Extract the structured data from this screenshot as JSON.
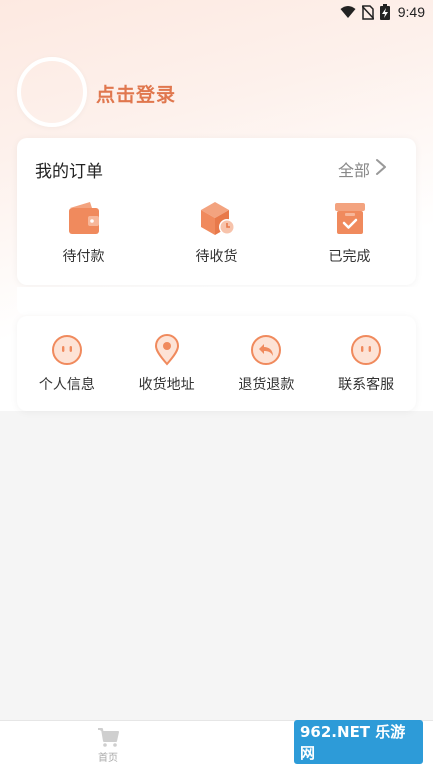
{
  "status_bar": {
    "time": "9:49"
  },
  "profile": {
    "login_label": "点击登录"
  },
  "orders": {
    "title": "我的订单",
    "all_label": "全部",
    "items": [
      {
        "label": "待付款",
        "icon": "wallet-icon"
      },
      {
        "label": "待收货",
        "icon": "box-clock-icon"
      },
      {
        "label": "已完成",
        "icon": "box-check-icon"
      }
    ]
  },
  "services": {
    "items": [
      {
        "label": "个人信息",
        "icon": "face-icon"
      },
      {
        "label": "收货地址",
        "icon": "location-pin-icon"
      },
      {
        "label": "退货退款",
        "icon": "return-arrow-icon"
      },
      {
        "label": "联系客服",
        "icon": "customer-service-icon"
      }
    ]
  },
  "bottom_nav": {
    "home_label": "首页"
  },
  "watermark": {
    "text": "962.NET 乐游网"
  },
  "colors": {
    "accent": "#e0774e",
    "icon_orange": "#f08a5d"
  }
}
